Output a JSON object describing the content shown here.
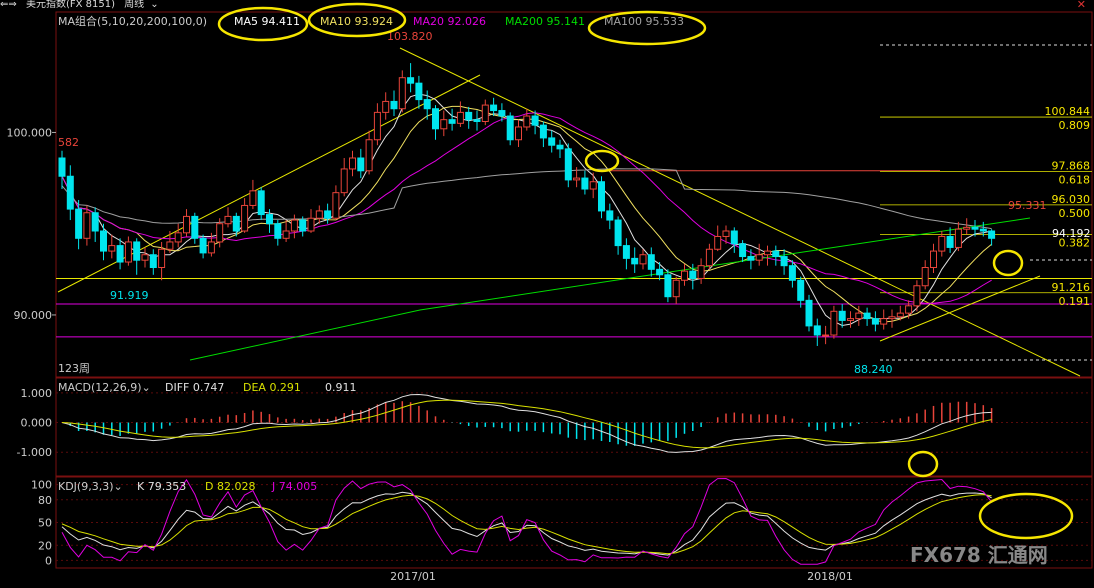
{
  "topbar": {
    "nav_icon": "left-right-arrow-icon",
    "title": "美元指数(FX 8151)",
    "period": "周线",
    "close_icon": "close-icon"
  },
  "colors": {
    "background": "#000000",
    "up": "#e8443a",
    "down": "#00e5ee",
    "ma5": "#e0e0e0",
    "ma10": "#f0e060",
    "ma20": "#e000e0",
    "ma100": "#a0a0a0",
    "ma200": "#00dd00",
    "annot": "#f6e600",
    "dde": "#d8e000"
  },
  "chart_data": [
    {
      "type": "candlestick",
      "panel": "main",
      "legend": {
        "title": "MA组合(5,10,20,200,100,0)",
        "items": [
          {
            "label": "MA5",
            "value": "94.411"
          },
          {
            "label": "MA10",
            "value": "93.924"
          },
          {
            "label": "MA20",
            "value": "92.026"
          },
          {
            "label": "MA200",
            "value": "95.141"
          },
          {
            "label": "MA100",
            "value": "95.533"
          }
        ]
      },
      "y_ticks": [
        "100.000",
        "90.000"
      ],
      "ylim": [
        86.6,
        106.6
      ],
      "annotations": {
        "left_value": "582",
        "high": "103.820",
        "low_left": "91.919",
        "low_right": "88.240",
        "current": "94.192",
        "last_high": "95.331",
        "period_count": "123周"
      },
      "fib_levels": [
        {
          "price": "100.844",
          "ratio": "0.809"
        },
        {
          "price": "97.868",
          "ratio": "0.618"
        },
        {
          "price": "96.030",
          "ratio": "0.500"
        },
        {
          "price": "",
          "ratio": "0.382"
        },
        {
          "price": "91.216",
          "ratio": "0.191"
        }
      ],
      "x_labels": [
        "2017/01",
        "2018/01"
      ],
      "ohlc": [
        [
          98.6,
          97.6,
          99.0,
          96.9
        ],
        [
          97.6,
          95.8,
          98.2,
          95.2
        ],
        [
          95.8,
          94.2,
          96.3,
          93.6
        ],
        [
          94.2,
          95.6,
          96.0,
          93.8
        ],
        [
          95.6,
          94.6,
          95.9,
          94.0
        ],
        [
          94.6,
          93.5,
          95.0,
          93.0
        ],
        [
          93.5,
          93.8,
          94.4,
          93.1
        ],
        [
          93.8,
          92.9,
          94.2,
          92.5
        ],
        [
          92.9,
          94.0,
          94.3,
          92.7
        ],
        [
          94.0,
          93.0,
          94.2,
          92.2
        ],
        [
          93.0,
          93.3,
          93.7,
          92.6
        ],
        [
          93.3,
          92.6,
          93.6,
          92.2
        ],
        [
          92.6,
          93.6,
          94.0,
          91.9
        ],
        [
          93.6,
          94.0,
          94.6,
          93.4
        ],
        [
          94.0,
          94.5,
          95.0,
          93.7
        ],
        [
          94.5,
          95.4,
          95.8,
          94.3
        ],
        [
          95.4,
          94.2,
          95.6,
          93.9
        ],
        [
          94.2,
          93.4,
          94.4,
          93.1
        ],
        [
          93.4,
          94.0,
          94.5,
          93.2
        ],
        [
          94.0,
          95.0,
          95.3,
          93.7
        ],
        [
          95.0,
          95.4,
          95.9,
          94.8
        ],
        [
          95.4,
          94.6,
          95.6,
          94.3
        ],
        [
          94.6,
          96.0,
          96.4,
          94.5
        ],
        [
          96.0,
          96.8,
          97.4,
          95.8
        ],
        [
          96.8,
          95.5,
          97.0,
          95.2
        ],
        [
          95.5,
          95.0,
          95.8,
          94.5
        ],
        [
          95.0,
          94.2,
          95.2,
          93.8
        ],
        [
          94.2,
          94.6,
          95.2,
          94.0
        ],
        [
          94.6,
          95.2,
          95.5,
          94.2
        ],
        [
          95.2,
          94.6,
          95.4,
          94.3
        ],
        [
          94.6,
          95.3,
          95.8,
          94.5
        ],
        [
          95.3,
          95.7,
          96.0,
          95.0
        ],
        [
          95.7,
          95.3,
          96.1,
          95.0
        ],
        [
          95.3,
          96.7,
          97.1,
          95.2
        ],
        [
          96.7,
          98.0,
          98.6,
          96.5
        ],
        [
          98.0,
          98.6,
          99.0,
          97.6
        ],
        [
          98.6,
          97.9,
          99.1,
          97.5
        ],
        [
          97.9,
          99.6,
          100.1,
          97.7
        ],
        [
          99.6,
          101.1,
          101.6,
          99.3
        ],
        [
          101.1,
          101.7,
          102.2,
          100.7
        ],
        [
          101.7,
          101.3,
          102.3,
          100.9
        ],
        [
          101.3,
          103.0,
          103.4,
          101.1
        ],
        [
          103.0,
          102.7,
          103.8,
          102.2
        ],
        [
          102.7,
          101.8,
          103.1,
          101.3
        ],
        [
          101.8,
          101.3,
          102.3,
          100.7
        ],
        [
          101.3,
          100.2,
          101.5,
          99.6
        ],
        [
          100.2,
          100.7,
          101.2,
          99.8
        ],
        [
          100.7,
          100.5,
          101.3,
          100.1
        ],
        [
          100.5,
          101.1,
          101.7,
          100.3
        ],
        [
          101.1,
          100.7,
          101.4,
          100.2
        ],
        [
          100.7,
          100.6,
          101.2,
          100.1
        ],
        [
          100.6,
          101.5,
          101.8,
          100.4
        ],
        [
          101.5,
          101.2,
          101.9,
          100.9
        ],
        [
          101.2,
          100.9,
          101.6,
          100.6
        ],
        [
          100.9,
          99.6,
          101.1,
          99.3
        ],
        [
          99.6,
          100.3,
          100.7,
          99.2
        ],
        [
          100.3,
          100.9,
          101.3,
          100.1
        ],
        [
          100.9,
          100.4,
          101.2,
          99.9
        ],
        [
          100.4,
          99.7,
          100.6,
          99.2
        ],
        [
          99.7,
          99.3,
          100.1,
          98.9
        ],
        [
          99.3,
          99.1,
          99.6,
          98.6
        ],
        [
          99.1,
          97.4,
          99.4,
          97.0
        ],
        [
          97.4,
          97.5,
          98.1,
          97.0
        ],
        [
          97.5,
          96.9,
          97.9,
          96.6
        ],
        [
          96.9,
          97.3,
          97.8,
          96.4
        ],
        [
          97.3,
          95.7,
          97.6,
          95.3
        ],
        [
          95.7,
          95.2,
          96.1,
          94.7
        ],
        [
          95.2,
          93.8,
          95.4,
          93.3
        ],
        [
          93.8,
          93.1,
          94.2,
          92.5
        ],
        [
          93.1,
          92.8,
          93.7,
          92.3
        ],
        [
          92.8,
          93.3,
          93.6,
          92.5
        ],
        [
          93.3,
          92.5,
          93.7,
          92.1
        ],
        [
          92.5,
          92.2,
          92.9,
          91.9
        ],
        [
          92.2,
          91.0,
          92.5,
          90.7
        ],
        [
          91.0,
          91.9,
          92.1,
          90.6
        ],
        [
          91.9,
          92.4,
          92.8,
          91.6
        ],
        [
          92.4,
          92.0,
          92.8,
          91.4
        ],
        [
          92.0,
          92.7,
          93.1,
          91.7
        ],
        [
          92.7,
          93.6,
          93.9,
          92.5
        ],
        [
          93.6,
          94.3,
          94.9,
          93.5
        ],
        [
          94.3,
          94.6,
          94.9,
          93.9
        ],
        [
          94.6,
          93.9,
          94.8,
          93.4
        ],
        [
          93.9,
          93.2,
          94.1,
          92.9
        ],
        [
          93.2,
          93.0,
          93.6,
          92.5
        ],
        [
          93.0,
          93.3,
          93.9,
          92.7
        ],
        [
          93.3,
          93.5,
          93.8,
          92.7
        ],
        [
          93.5,
          93.2,
          93.8,
          92.7
        ],
        [
          93.2,
          92.7,
          93.6,
          92.2
        ],
        [
          92.7,
          91.9,
          93.0,
          91.5
        ],
        [
          91.9,
          90.8,
          92.1,
          90.4
        ],
        [
          90.8,
          89.4,
          91.1,
          89.1
        ],
        [
          89.4,
          88.9,
          89.8,
          88.3
        ],
        [
          88.9,
          88.9,
          89.4,
          88.4
        ],
        [
          88.9,
          90.2,
          90.5,
          88.7
        ],
        [
          90.2,
          89.7,
          90.6,
          89.3
        ],
        [
          89.7,
          89.8,
          90.2,
          89.3
        ],
        [
          89.8,
          90.1,
          90.5,
          89.4
        ],
        [
          90.1,
          89.8,
          90.4,
          89.4
        ],
        [
          89.8,
          89.5,
          90.2,
          89.1
        ],
        [
          89.5,
          89.8,
          90.3,
          89.2
        ],
        [
          89.8,
          89.9,
          90.3,
          89.3
        ],
        [
          89.9,
          90.1,
          90.5,
          89.7
        ],
        [
          90.1,
          90.5,
          90.8,
          89.8
        ],
        [
          90.5,
          91.6,
          91.9,
          90.2
        ],
        [
          91.6,
          92.6,
          93.0,
          91.4
        ],
        [
          92.6,
          93.5,
          93.9,
          92.3
        ],
        [
          93.5,
          94.3,
          94.6,
          93.2
        ],
        [
          94.3,
          93.7,
          94.8,
          93.4
        ],
        [
          93.7,
          94.7,
          95.1,
          93.5
        ],
        [
          94.7,
          94.8,
          95.3,
          94.4
        ],
        [
          94.8,
          94.7,
          95.2,
          94.3
        ],
        [
          94.7,
          94.6,
          95.1,
          94.3
        ],
        [
          94.6,
          94.2,
          94.7,
          93.8
        ]
      ]
    },
    {
      "type": "macd",
      "panel": "macd",
      "legend": {
        "title": "MACD(12,26,9)",
        "items": [
          {
            "label": "DIFF",
            "value": "0.747"
          },
          {
            "label": "DEA",
            "value": "0.291"
          },
          {
            "label": "",
            "value": "0.911"
          }
        ]
      },
      "y_ticks": [
        "1.000",
        "0.000",
        "-1.000"
      ],
      "ylim": [
        -1.8,
        1.5
      ]
    },
    {
      "type": "kdj",
      "panel": "kdj",
      "legend": {
        "title": "KDJ(9,3,3)",
        "items": [
          {
            "label": "K",
            "value": "79.353"
          },
          {
            "label": "D",
            "value": "82.028"
          },
          {
            "label": "J",
            "value": "74.005"
          }
        ]
      },
      "y_ticks": [
        "100",
        "80",
        "50",
        "20",
        "0"
      ],
      "ylim": [
        -10,
        110
      ]
    }
  ],
  "watermark": "FX678 汇通网"
}
